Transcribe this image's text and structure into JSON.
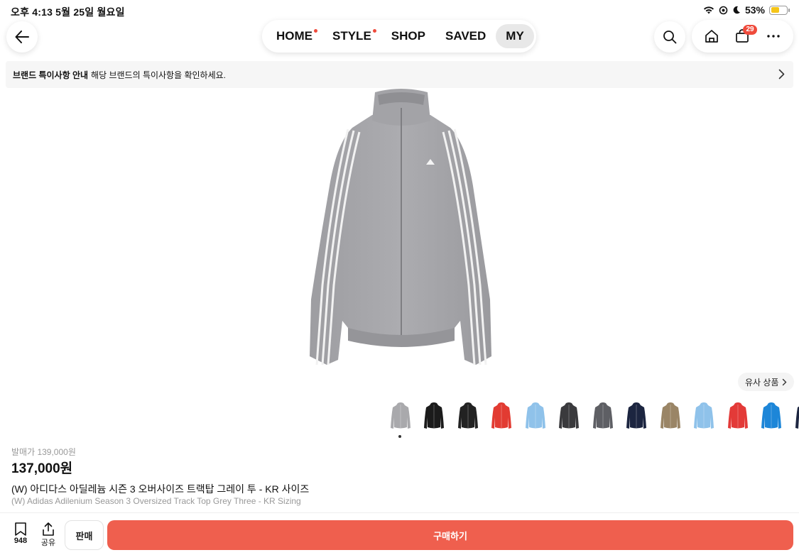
{
  "status": {
    "time": "오후 4:13   5월 25일 월요일",
    "battery": "53%"
  },
  "nav": {
    "tabs": [
      {
        "label": "HOME",
        "dot": true
      },
      {
        "label": "STYLE",
        "dot": true
      },
      {
        "label": "SHOP",
        "dot": false
      },
      {
        "label": "SAVED",
        "dot": false
      },
      {
        "label": "MY",
        "dot": false,
        "active": true
      }
    ],
    "cart_badge": "29"
  },
  "notice": {
    "title": "브랜드 특이사항 안내",
    "text": "해당 브랜드의 특이사항을 확인하세요."
  },
  "similar": {
    "label": "유사 상품"
  },
  "thumbnails": [
    {
      "color": "#a9a9ac",
      "selected": true
    },
    {
      "color": "#1b1b1b"
    },
    {
      "color": "#222222"
    },
    {
      "color": "#e23b32"
    },
    {
      "color": "#8fc2ea"
    },
    {
      "color": "#3a3a3d"
    },
    {
      "color": "#5e5f64"
    },
    {
      "color": "#1c2540"
    },
    {
      "color": "#9a8566"
    },
    {
      "color": "#8fc2ea"
    },
    {
      "color": "#e33a38"
    },
    {
      "color": "#1d86d8"
    },
    {
      "color": "#1c2540"
    }
  ],
  "product": {
    "original_price": "발매가 139,000원",
    "price": "137,000원",
    "title_ko": "(W) 아디다스 아딜레늄 시즌 3 오버사이즈 트랙탑 그레이 투 - KR 사이즈",
    "title_en": "(W) Adidas Adilenium Season 3 Oversized Track Top Grey Three - KR Sizing"
  },
  "bottom": {
    "bookmark_count": "948",
    "share_label": "공유",
    "sell_label": "판매",
    "buy_label": "구매하기"
  }
}
